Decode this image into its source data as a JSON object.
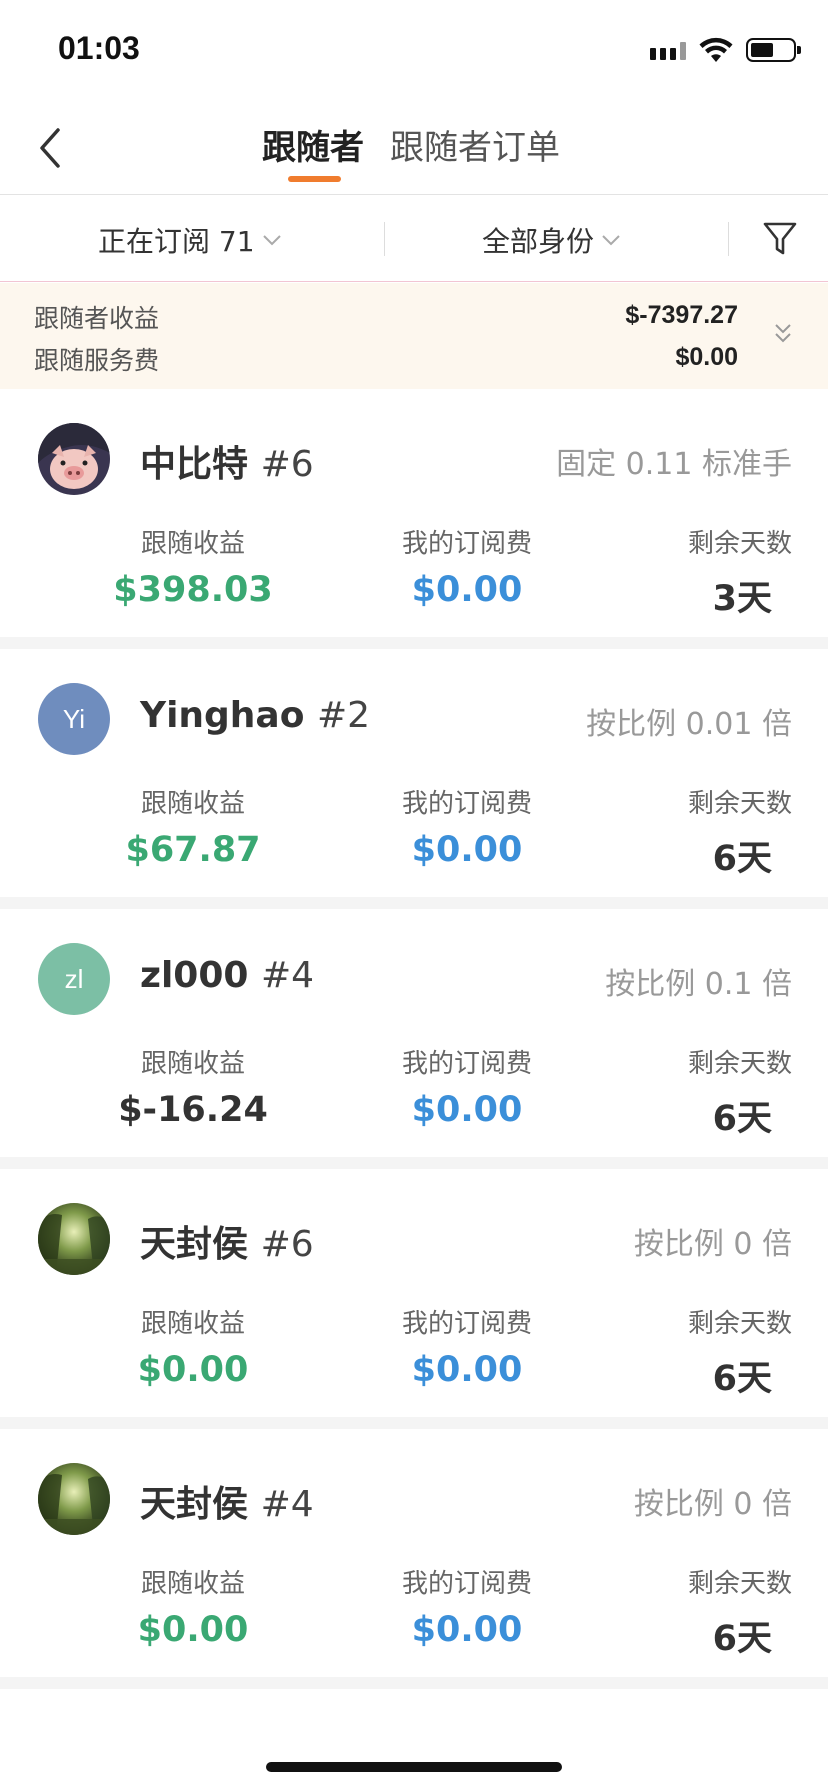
{
  "status_bar": {
    "time": "01:03"
  },
  "nav": {
    "tabs": [
      {
        "label": "跟随者",
        "active": true
      },
      {
        "label": "跟随者订单",
        "active": false
      }
    ],
    "accent_color": "#f07c2e"
  },
  "filters": {
    "subscription": "正在订阅 71",
    "role": "全部身份"
  },
  "summary": {
    "earnings_label": "跟随者收益",
    "earnings_value": "$-7397.27",
    "fee_label": "跟随服务费",
    "fee_value": "$0.00"
  },
  "followers": [
    {
      "name": "中比特",
      "index": "#6",
      "mode": "固定 0.11 标准手",
      "avatar_type": "pig-photo",
      "earnings_label": "跟随收益",
      "earnings": "$398.03",
      "earnings_color": "#3aa873",
      "fee_label": "我的订阅费",
      "fee": "$0.00",
      "days_label": "剩余天数",
      "days": "3天"
    },
    {
      "name": "Yinghao",
      "index": "#2",
      "mode": "按比例 0.01 倍",
      "avatar_type": "initials",
      "avatar_text": "Yi",
      "avatar_color": "#6f8dbe",
      "earnings_label": "跟随收益",
      "earnings": "$67.87",
      "earnings_color": "#3aa873",
      "fee_label": "我的订阅费",
      "fee": "$0.00",
      "days_label": "剩余天数",
      "days": "6天"
    },
    {
      "name": "zl000",
      "index": "#4",
      "mode": "按比例 0.1 倍",
      "avatar_type": "initials",
      "avatar_text": "zl",
      "avatar_color": "#7cbfa5",
      "earnings_label": "跟随收益",
      "earnings": "$-16.24",
      "earnings_color": "#333333",
      "fee_label": "我的订阅费",
      "fee": "$0.00",
      "days_label": "剩余天数",
      "days": "6天"
    },
    {
      "name": "天封侯",
      "index": "#6",
      "mode": "按比例 0 倍",
      "avatar_type": "forest-photo",
      "earnings_label": "跟随收益",
      "earnings": "$0.00",
      "earnings_color": "#3aa873",
      "fee_label": "我的订阅费",
      "fee": "$0.00",
      "days_label": "剩余天数",
      "days": "6天"
    },
    {
      "name": "天封侯",
      "index": "#4",
      "mode": "按比例 0 倍",
      "avatar_type": "forest-photo",
      "earnings_label": "跟随收益",
      "earnings": "$0.00",
      "earnings_color": "#3aa873",
      "fee_label": "我的订阅费",
      "fee": "$0.00",
      "days_label": "剩余天数",
      "days": "6天"
    }
  ]
}
